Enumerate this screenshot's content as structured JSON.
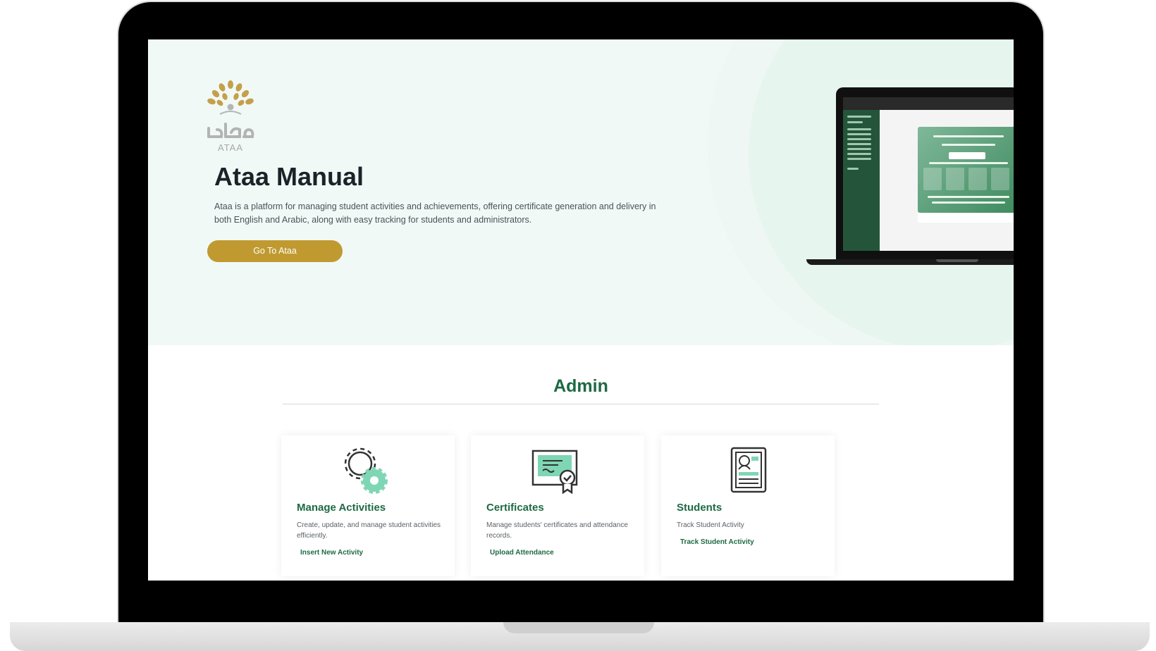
{
  "hero": {
    "logo_caption": "ATAA",
    "title": "Ataa Manual",
    "description": "Ataa is a platform for managing student activities and achievements, offering certificate generation and delivery in both English and Arabic, along with easy tracking for students and administrators.",
    "cta_label": "Go To Ataa"
  },
  "admin": {
    "title": "Admin",
    "cards": [
      {
        "title": "Manage Activities",
        "description": "Create, update, and manage student activities efficiently.",
        "link": "Insert New Activity",
        "icon": "gears-icon"
      },
      {
        "title": "Certificates",
        "description": "Manage students' certificates and attendance records.",
        "link": "Upload Attendance",
        "icon": "certificate-icon"
      },
      {
        "title": "Students",
        "description": "Track Student Activity",
        "link": "Track Student Activity",
        "icon": "student-profile-icon"
      }
    ]
  },
  "colors": {
    "brand_green": "#1d6a44",
    "brand_gold": "#c09a30",
    "hero_bg": "#f1f9f7",
    "icon_mint": "#7fd6b4"
  }
}
